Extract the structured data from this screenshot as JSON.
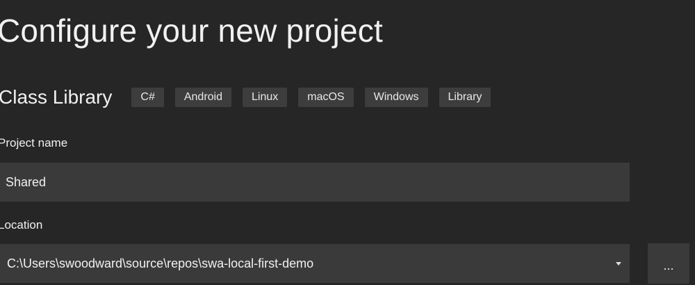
{
  "header": {
    "title": "Configure your new project"
  },
  "template": {
    "name": "Class Library",
    "tags": [
      "C#",
      "Android",
      "Linux",
      "macOS",
      "Windows",
      "Library"
    ]
  },
  "project_name": {
    "label": "Project name",
    "value": "Shared"
  },
  "location": {
    "label": "Location",
    "value": "C:\\Users\\swoodward\\source\\repos\\swa-local-first-demo",
    "browse_label": "..."
  }
}
